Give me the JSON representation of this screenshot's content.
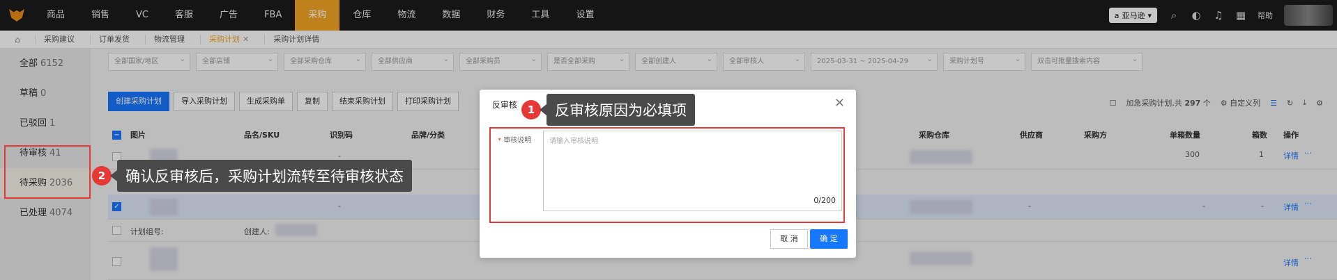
{
  "topnav": {
    "items": [
      "商品",
      "销售",
      "VC",
      "客服",
      "广告",
      "FBA",
      "采购",
      "仓库",
      "物流",
      "数据",
      "财务",
      "工具",
      "设置"
    ],
    "active_index": 6,
    "marketplace": "亚马逊",
    "help": "帮助",
    "icons": [
      "search-icon",
      "headset-icon",
      "bell-icon",
      "grid-icon"
    ]
  },
  "tabs": {
    "items": [
      "采购建议",
      "订单发货",
      "物流管理",
      "采购计划",
      "采购计划详情"
    ],
    "active_index": 3
  },
  "sidebar": {
    "items": [
      {
        "label": "全部",
        "count": "6152"
      },
      {
        "label": "草稿",
        "count": "0"
      },
      {
        "label": "已驳回",
        "count": "1"
      },
      {
        "label": "待审核",
        "count": "41"
      },
      {
        "label": "待采购",
        "count": "2036"
      },
      {
        "label": "已处理",
        "count": "4074"
      }
    ]
  },
  "filters": [
    "全部国家/地区",
    "全部店铺",
    "全部采购仓库",
    "全部供应商",
    "全部采购员",
    "是否全部采购",
    "全部创建人",
    "全部审核人",
    "2025-03-31 ~ 2025-04-29",
    "采购计划号",
    "双击可批量搜索内容"
  ],
  "toolbar": {
    "buttons": [
      "创建采购计划",
      "导入采购计划",
      "生成采购单",
      "复制",
      "结束采购计划",
      "打印采购计划"
    ],
    "urgent_label": "加急采购计划,共",
    "total": "297",
    "unit": "个",
    "custom_cols": "自定义列"
  },
  "table": {
    "headers": [
      "图片",
      "品名/SKU",
      "识别码",
      "品牌/分类",
      "采购仓库",
      "供应商",
      "采购方",
      "单箱数量",
      "箱数",
      "操作"
    ],
    "row1": {
      "qty": "300",
      "boxes": "1",
      "action": "详情"
    },
    "row2": {
      "action": "详情",
      "dash": "-"
    },
    "group": {
      "plan_group": "计划组号:",
      "creator": "创建人:"
    },
    "row3": {
      "action": "详情"
    }
  },
  "modal": {
    "title": "反审核",
    "field_label": "审核说明",
    "placeholder": "请输入审核说明",
    "counter": "0/200",
    "cancel": "取 消",
    "ok": "确 定"
  },
  "callouts": [
    {
      "num": "1",
      "text": "反审核原因为必填项"
    },
    {
      "num": "2",
      "text": "确认反审核后，采购计划流转至待审核状态"
    }
  ],
  "colors": {
    "accent": "#f5a623",
    "primary": "#1677ff",
    "alert": "#e53935"
  }
}
